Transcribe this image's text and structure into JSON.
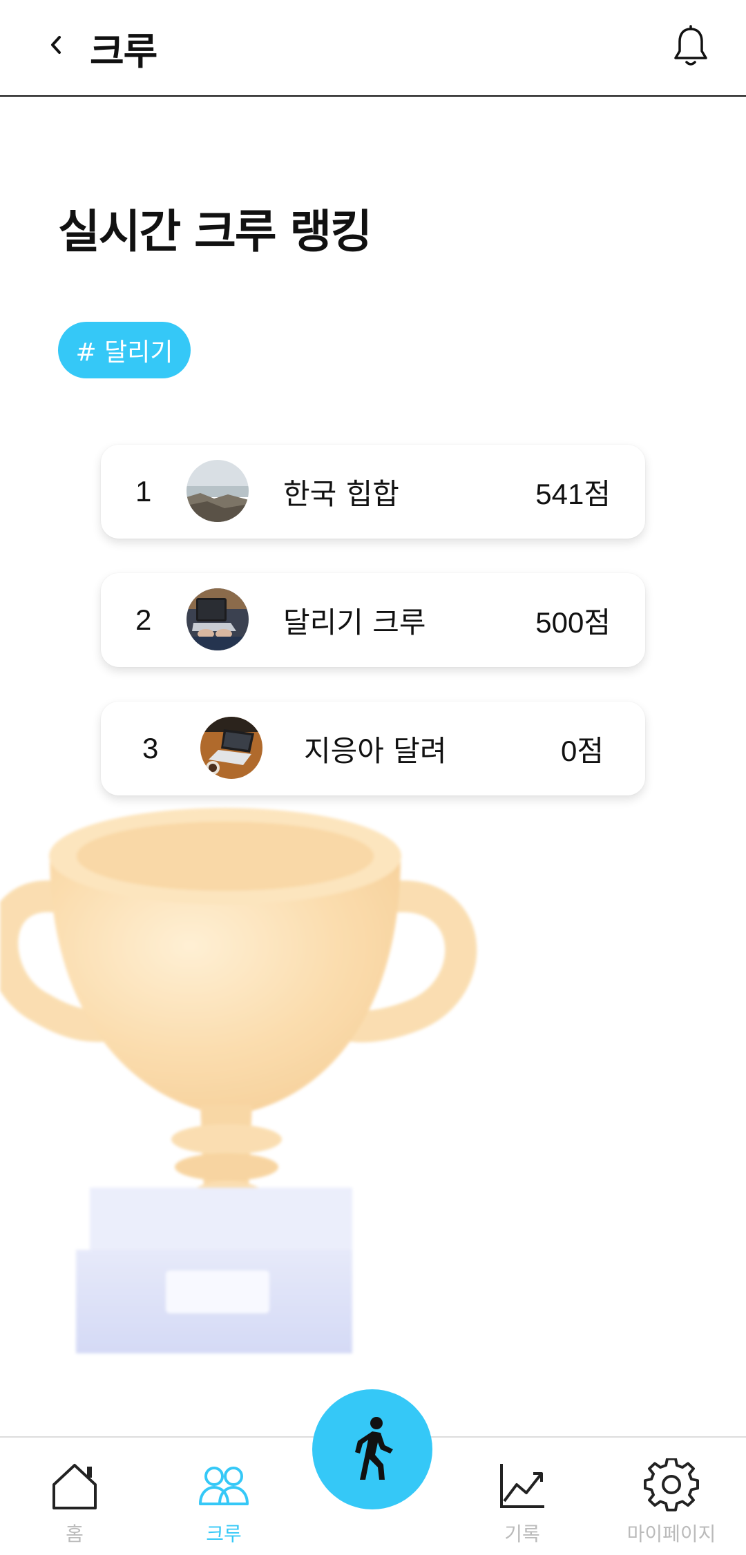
{
  "header": {
    "title": "크루",
    "back_icon": "chevron-left-icon",
    "notification_icon": "bell-icon"
  },
  "main": {
    "section_title": "실시간 크루 랭킹",
    "tag": "# 달리기",
    "rankings": [
      {
        "rank": "1",
        "name": "한국 힙합",
        "score": "541점"
      },
      {
        "rank": "2",
        "name": "달리기 크루",
        "score": "500점"
      },
      {
        "rank": "3",
        "name": "지응아 달려",
        "score": "0점"
      }
    ]
  },
  "bottom_nav": {
    "items": [
      {
        "label": "홈",
        "icon": "home-icon",
        "active": false
      },
      {
        "label": "크루",
        "icon": "users-icon",
        "active": true
      },
      {
        "label": "기록",
        "icon": "chart-icon",
        "active": false
      },
      {
        "label": "마이페이지",
        "icon": "gear-icon",
        "active": false
      }
    ],
    "fab_icon": "walking-person-icon"
  },
  "colors": {
    "accent": "#35c8f7",
    "inactive": "#bbbbbb",
    "text": "#111111"
  }
}
